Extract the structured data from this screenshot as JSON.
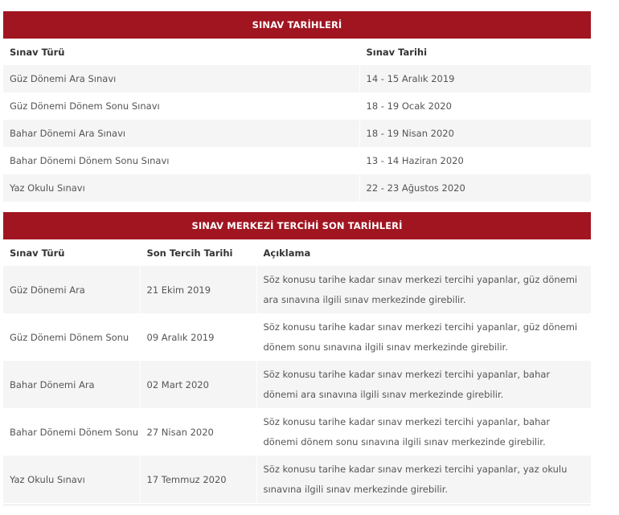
{
  "table1": {
    "title": "SINAV TARİHLERİ",
    "headers": [
      "Sınav Türü",
      "Sınav Tarihi"
    ],
    "rows": [
      [
        "Güz Dönemi Ara Sınavı",
        "14 - 15 Aralık 2019"
      ],
      [
        "Güz Dönemi Dönem Sonu Sınavı",
        "18 - 19 Ocak 2020"
      ],
      [
        "Bahar Dönemi Ara Sınavı",
        "18 - 19 Nisan 2020"
      ],
      [
        "Bahar Dönemi Dönem Sonu Sınavı",
        "13 - 14 Haziran 2020"
      ],
      [
        "Yaz Okulu Sınavı",
        "22 - 23 Ağustos 2020"
      ]
    ]
  },
  "table2": {
    "title": "SINAV MERKEZİ TERCİHİ SON TARİHLERİ",
    "headers": [
      "Sınav Türü",
      "Son Tercih Tarihi",
      "Açıklama"
    ],
    "rows": [
      [
        "Güz Dönemi Ara",
        "21 Ekim 2019",
        "Söz konusu tarihe kadar sınav merkezi tercihi yapanlar, güz dönemi ara sınavına ilgili sınav merkezinde girebilir."
      ],
      [
        "Güz Dönemi Dönem Sonu",
        "09 Aralık 2019",
        "Söz konusu tarihe kadar sınav merkezi tercihi yapanlar, güz dönemi dönem sonu sınavına ilgili sınav merkezinde girebilir."
      ],
      [
        "Bahar Dönemi Ara",
        "02 Mart 2020",
        "Söz konusu tarihe kadar sınav merkezi tercihi yapanlar, bahar dönemi ara sınavına ilgili sınav merkezinde girebilir."
      ],
      [
        "Bahar Dönemi Dönem Sonu",
        "27 Nisan 2020",
        "Söz konusu tarihe kadar sınav merkezi tercihi yapanlar, bahar dönemi dönem sonu sınavına ilgili sınav merkezinde girebilir."
      ],
      [
        "Yaz Okulu Sınavı",
        "17 Temmuz 2020",
        "Söz konusu tarihe kadar sınav merkezi tercihi yapanlar, yaz okulu sınavına ilgili sınav merkezinde girebilir."
      ]
    ]
  }
}
